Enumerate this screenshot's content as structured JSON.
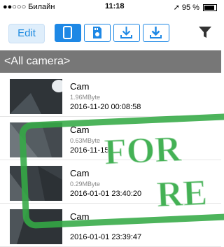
{
  "status_bar": {
    "carrier": "●●○○○ Билайн",
    "time": "11:18",
    "battery": "95 %"
  },
  "toolbar": {
    "edit_label": "Edit",
    "buttons": [
      "phone-icon",
      "camera-storage-icon",
      "download-icon",
      "download-alt-icon",
      "filter-icon"
    ],
    "accent_color": "#1e88e5"
  },
  "camera_selector": {
    "label": "<All camera>"
  },
  "recordings": [
    {
      "name": "Cam",
      "size": "1.96MByte",
      "date": "2016-11-20 00:08:58"
    },
    {
      "name": "Cam",
      "size": "0.63MByte",
      "date": "2016-11-15"
    },
    {
      "name": "Cam",
      "size": "0.29MByte",
      "date": "2016-01-01 23:40:20"
    },
    {
      "name": "Cam",
      "size": "",
      "date": "2016-01-01 23:39:47"
    }
  ],
  "watermark": {
    "line1": "FOR",
    "line2": "RE",
    "color": "#34aa46"
  }
}
